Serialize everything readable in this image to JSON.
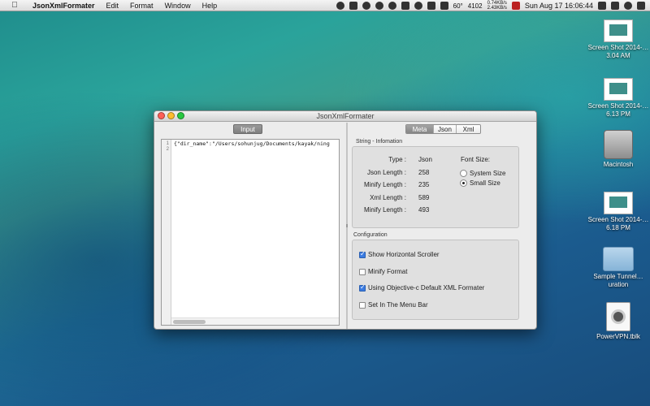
{
  "menubar": {
    "app_name": "JsonXmlFormater",
    "items": [
      "Edit",
      "Format",
      "Window",
      "Help"
    ],
    "temperature": "60°",
    "number": "4102",
    "net_up": "0.74KB/s",
    "net_down": "2.43KB/s",
    "clock": "Sun Aug 17  16:06:44"
  },
  "desktop": {
    "icons": [
      {
        "label": "Screen Shot 2014-…3.04 AM"
      },
      {
        "label": "Screen Shot 2014-…6.13 PM"
      },
      {
        "label": "Macintosh"
      },
      {
        "label": "Screen Shot 2014-…6.18 PM"
      },
      {
        "label": "Sample Tunnel…uration"
      },
      {
        "label": "PowerVPN.tblk"
      }
    ]
  },
  "window": {
    "title": "JsonXmlFormater",
    "input_label": "Input",
    "editor": {
      "line_numbers": [
        "1",
        "2"
      ],
      "line1": "{\"dir_name\":\"/Users/sohunjug/Documents/kayak/ning",
      "line2": ""
    },
    "tabs": {
      "meta": "Meta",
      "json": "Json",
      "xml": "Xml"
    },
    "info_group": {
      "title": "String - Infomation",
      "rows": [
        {
          "label": "Type :",
          "value": "Json"
        },
        {
          "label": "Json Length :",
          "value": "258"
        },
        {
          "label": "Minify Length :",
          "value": "235"
        },
        {
          "label": "Xml Length :",
          "value": "589"
        },
        {
          "label": "Minify Length :",
          "value": "493"
        }
      ],
      "font_size_label": "Font Size:",
      "font_options": [
        "System Size",
        "Small Size"
      ],
      "font_selected": "Small Size"
    },
    "config_group": {
      "title": "Configuration",
      "options": [
        {
          "label": "Show Horizontal Scroller",
          "checked": true
        },
        {
          "label": "Minify Format",
          "checked": false
        },
        {
          "label": "Using Objective-c Default XML Formater",
          "checked": true
        },
        {
          "label": "Set In The Menu Bar",
          "checked": false
        }
      ]
    }
  }
}
